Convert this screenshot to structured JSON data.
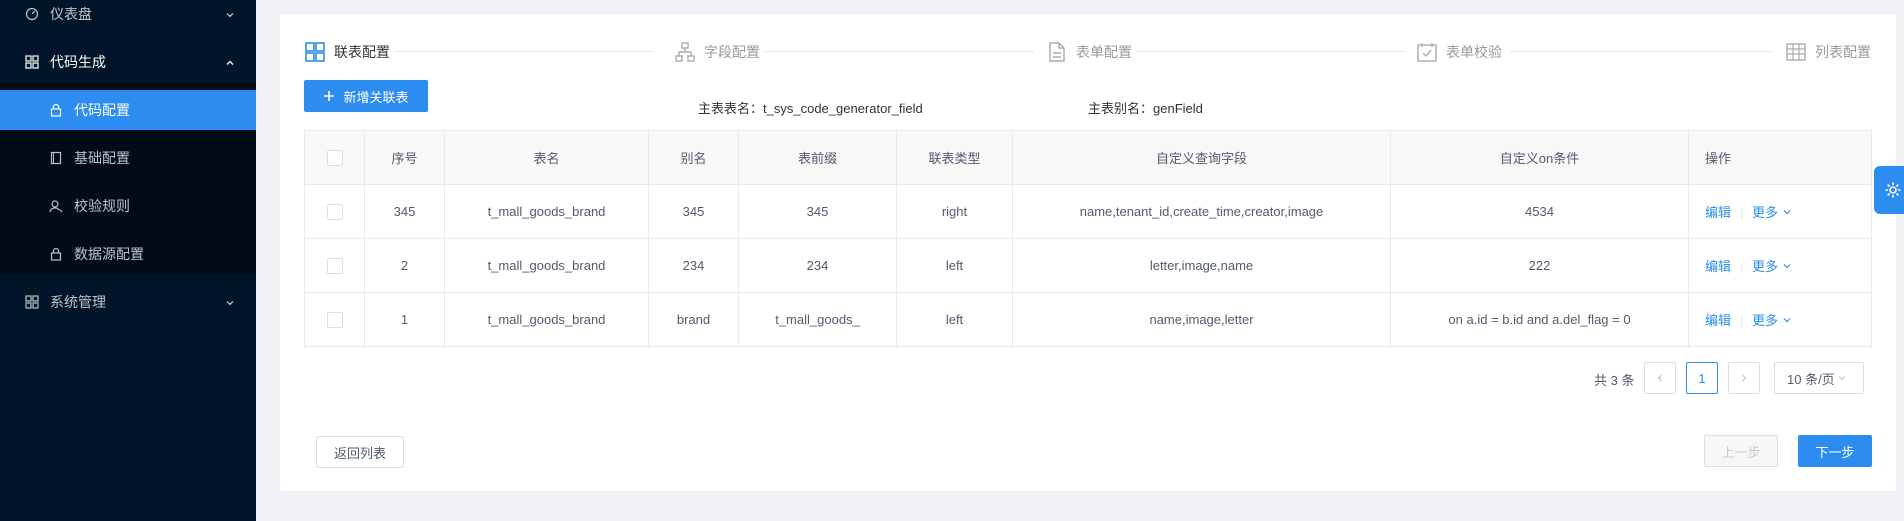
{
  "sidebar": {
    "items": [
      {
        "label": "仪表盘"
      },
      {
        "label": "代码生成"
      },
      {
        "label": "代码配置"
      },
      {
        "label": "基础配置"
      },
      {
        "label": "校验规则"
      },
      {
        "label": "数据源配置"
      },
      {
        "label": "系统管理"
      }
    ]
  },
  "steps": [
    {
      "label": "联表配置"
    },
    {
      "label": "字段配置"
    },
    {
      "label": "表单配置"
    },
    {
      "label": "表单校验"
    },
    {
      "label": "列表配置"
    }
  ],
  "toolbar": {
    "add_label": "新增关联表",
    "main_table_key": "主表表名：",
    "main_table_value": "t_sys_code_generator_field",
    "main_alias_key": "主表别名：",
    "main_alias_value": "genField"
  },
  "table": {
    "columns": [
      "序号",
      "表名",
      "别名",
      "表前缀",
      "联表类型",
      "自定义查询字段",
      "自定义on条件",
      "操作"
    ],
    "rows": [
      {
        "no": "345",
        "name": "t_mall_goods_brand",
        "alias": "345",
        "prefix": "345",
        "type": "right",
        "fields": "name,tenant_id,create_time,creator,image",
        "on": "4534",
        "edit": "编辑",
        "more": "更多"
      },
      {
        "no": "2",
        "name": "t_mall_goods_brand",
        "alias": "234",
        "prefix": "234",
        "type": "left",
        "fields": "letter,image,name",
        "on": "222",
        "edit": "编辑",
        "more": "更多"
      },
      {
        "no": "1",
        "name": "t_mall_goods_brand",
        "alias": "brand",
        "prefix": "t_mall_goods_",
        "type": "left",
        "fields": "name,image,letter",
        "on": "on a.id = b.id and a.del_flag = 0",
        "edit": "编辑",
        "more": "更多"
      }
    ]
  },
  "pagination": {
    "total": "共 3 条",
    "current": "1",
    "page_size": "10 条/页"
  },
  "footer": {
    "back_label": "返回列表",
    "prev_label": "上一步",
    "next_label": "下一步"
  },
  "colors": {
    "primary": "#2d8cf0",
    "sidebar": "#001529"
  }
}
